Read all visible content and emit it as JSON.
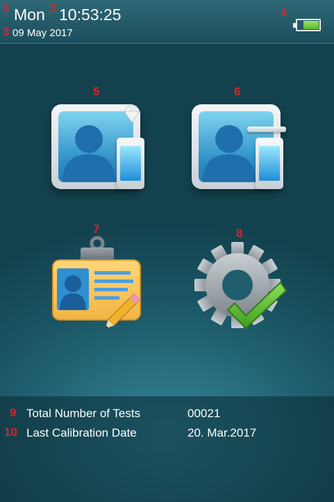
{
  "status": {
    "day": "Mon",
    "time": "10:53:25",
    "date": "09 May 2017",
    "battery_level": 0.8
  },
  "markers": [
    "1",
    "2",
    "3",
    "4",
    "5",
    "6",
    "7",
    "8",
    "9",
    "10"
  ],
  "info": {
    "total_tests_label": "Total Number of Tests",
    "total_tests_value": "00021",
    "calibration_label": "Last Calibration Date",
    "calibration_value": "20. Mar.2017"
  },
  "icons": {
    "tile5": "user-card-phone-icon",
    "tile6": "user-card-device-icon",
    "tile7": "id-badge-edit-icon",
    "tile8": "settings-gear-check-icon"
  },
  "colors": {
    "background": "#1e5e6e",
    "marker": "#d8262b",
    "battery": "#5cb82e",
    "check": "#4fb82a"
  }
}
